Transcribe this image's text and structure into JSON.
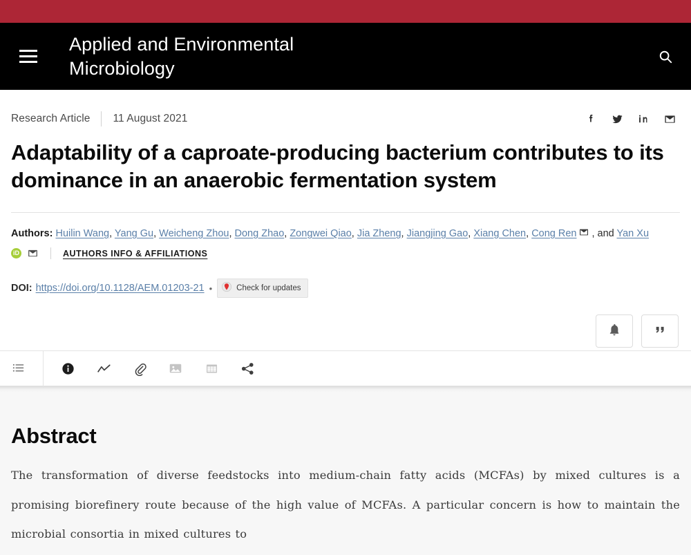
{
  "header": {
    "journal_title": "Applied and Environmental Microbiology",
    "menu_icon": "hamburger-menu-icon",
    "search_icon": "search-icon",
    "bar_color": "#ad2636",
    "background_color": "#000000"
  },
  "meta": {
    "article_type": "Research Article",
    "publication_date": "11 August 2021",
    "social": [
      {
        "name": "facebook-icon",
        "label": "f"
      },
      {
        "name": "twitter-icon",
        "label": "t"
      },
      {
        "name": "linkedin-icon",
        "label": "in"
      },
      {
        "name": "email-icon",
        "label": "email"
      }
    ]
  },
  "article": {
    "title": "Adaptability of a caproate-producing bacterium contributes to its dominance in an anaerobic fermentation system",
    "authors_label": "Authors",
    "authors": [
      "Huilin Wang",
      "Yang Gu",
      "Weicheng Zhou",
      "Dong Zhao",
      "Zongwei Qiao",
      "Jia Zheng",
      "Jiangjing Gao",
      "Xiang Chen",
      "Cong Ren",
      "Yan Xu"
    ],
    "corresponding_author_index": 8,
    "and_text": "and",
    "affiliations_link": "AUTHORS INFO & AFFILIATIONS",
    "orcid_icon": "orcid-icon",
    "orcid_color": "#a6ce39",
    "doi_label": "DOI:",
    "doi_url": "https://doi.org/10.1128/AEM.01203-21",
    "separator_bullet": "•",
    "crossmark_label": "Check for updates"
  },
  "actions": [
    {
      "name": "alerts-button",
      "icon": "bell-icon"
    },
    {
      "name": "cite-button",
      "icon": "quote-icon"
    }
  ],
  "toolbar": [
    {
      "name": "toc-button",
      "icon": "list-icon"
    },
    {
      "name": "info-button",
      "icon": "info-circle-icon"
    },
    {
      "name": "metrics-button",
      "icon": "line-chart-icon"
    },
    {
      "name": "references-button",
      "icon": "paperclip-icon"
    },
    {
      "name": "figures-button",
      "icon": "image-icon"
    },
    {
      "name": "tables-button",
      "icon": "table-icon"
    },
    {
      "name": "share-button",
      "icon": "share-icon"
    }
  ],
  "abstract": {
    "heading": "Abstract",
    "text": "The transformation of diverse feedstocks into medium-chain fatty acids (MCFAs) by mixed cultures is a promising biorefinery route because of the high value of MCFAs. A particular concern is how to maintain the microbial consortia in mixed cultures to"
  }
}
